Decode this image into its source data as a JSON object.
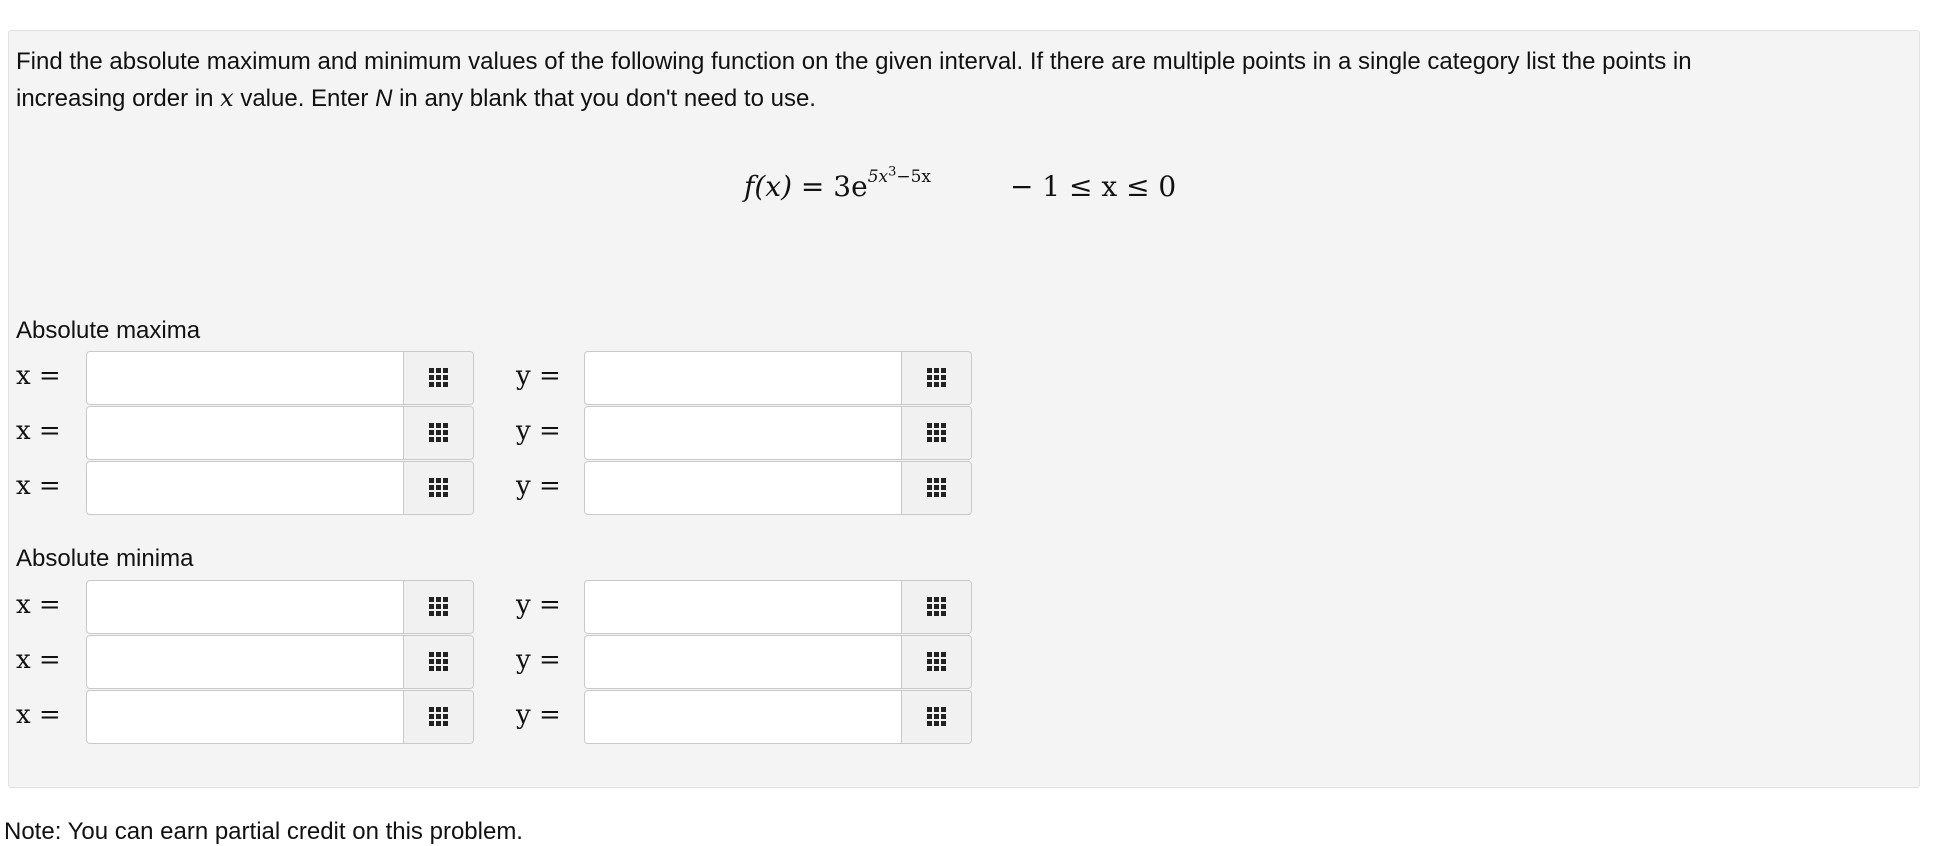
{
  "instructions": {
    "line1": "Find the absolute maximum and minimum values of the following function on the given interval. If there are multiple points in a single category list the points in",
    "line2_before_var": "increasing order in ",
    "line2_var": "x",
    "line2_mid": " value. Enter ",
    "line2_emph": "N",
    "line2_after": " in any blank that you don't need to use."
  },
  "equation": {
    "function_lhs": "f(x)",
    "equals": "=",
    "coefficient": "3e",
    "exponent_base": "5x",
    "exponent_power": "3",
    "exponent_tail": "−5x",
    "interval": "− 1 ≤ x ≤ 0"
  },
  "sections": [
    {
      "title": "Absolute maxima",
      "rows": [
        {
          "x_label": "x =",
          "x_value": "",
          "y_label": "y =",
          "y_value": ""
        },
        {
          "x_label": "x =",
          "x_value": "",
          "y_label": "y =",
          "y_value": ""
        },
        {
          "x_label": "x =",
          "x_value": "",
          "y_label": "y =",
          "y_value": ""
        }
      ]
    },
    {
      "title": "Absolute minima",
      "rows": [
        {
          "x_label": "x =",
          "x_value": "",
          "y_label": "y =",
          "y_value": ""
        },
        {
          "x_label": "x =",
          "x_value": "",
          "y_label": "y =",
          "y_value": ""
        },
        {
          "x_label": "x =",
          "x_value": "",
          "y_label": "y =",
          "y_value": ""
        }
      ]
    }
  ],
  "palette_icon": "grid-keypad-icon",
  "note_text": "Note: You can earn partial credit on this problem."
}
